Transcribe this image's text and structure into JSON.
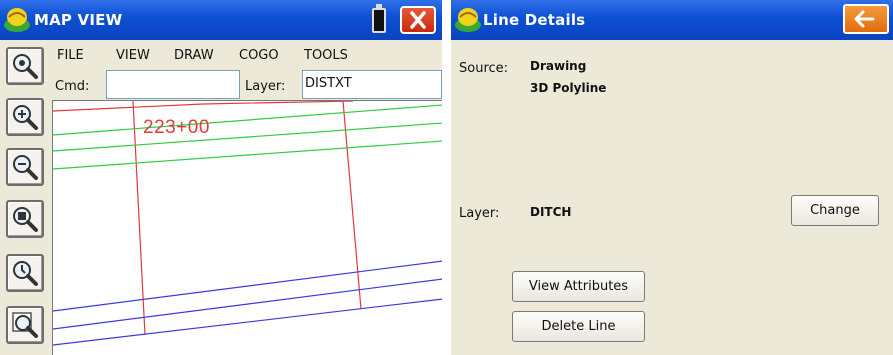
{
  "map_view": {
    "title": "MAP VIEW",
    "menu": [
      "FILE",
      "VIEW",
      "DRAW",
      "COGO",
      "TOOLS"
    ],
    "cmd_label": "Cmd:",
    "cmd_value": "",
    "layer_label": "Layer:",
    "layer_value": "DISTXT",
    "station_label": "223+00",
    "tools": [
      "zoom-extents-icon",
      "zoom-in-icon",
      "zoom-out-icon",
      "zoom-window-icon",
      "zoom-previous-icon",
      "zoom-object-icon"
    ],
    "line_colors": {
      "red": "#e23a3a",
      "green": "#2ecc40",
      "blue": "#3a3adf"
    }
  },
  "line_details": {
    "title": "Line Details",
    "source_label": "Source:",
    "source_value_1": "Drawing",
    "source_value_2": "3D Polyline",
    "layer_label": "Layer:",
    "layer_value": "DITCH",
    "change_button": "Change",
    "view_attributes_button": "View Attributes",
    "delete_line_button": "Delete Line"
  },
  "colors": {
    "titlebar": "#0d4fd3",
    "close": "#c8290f",
    "back": "#e26c0e",
    "background": "#ece9d8"
  }
}
